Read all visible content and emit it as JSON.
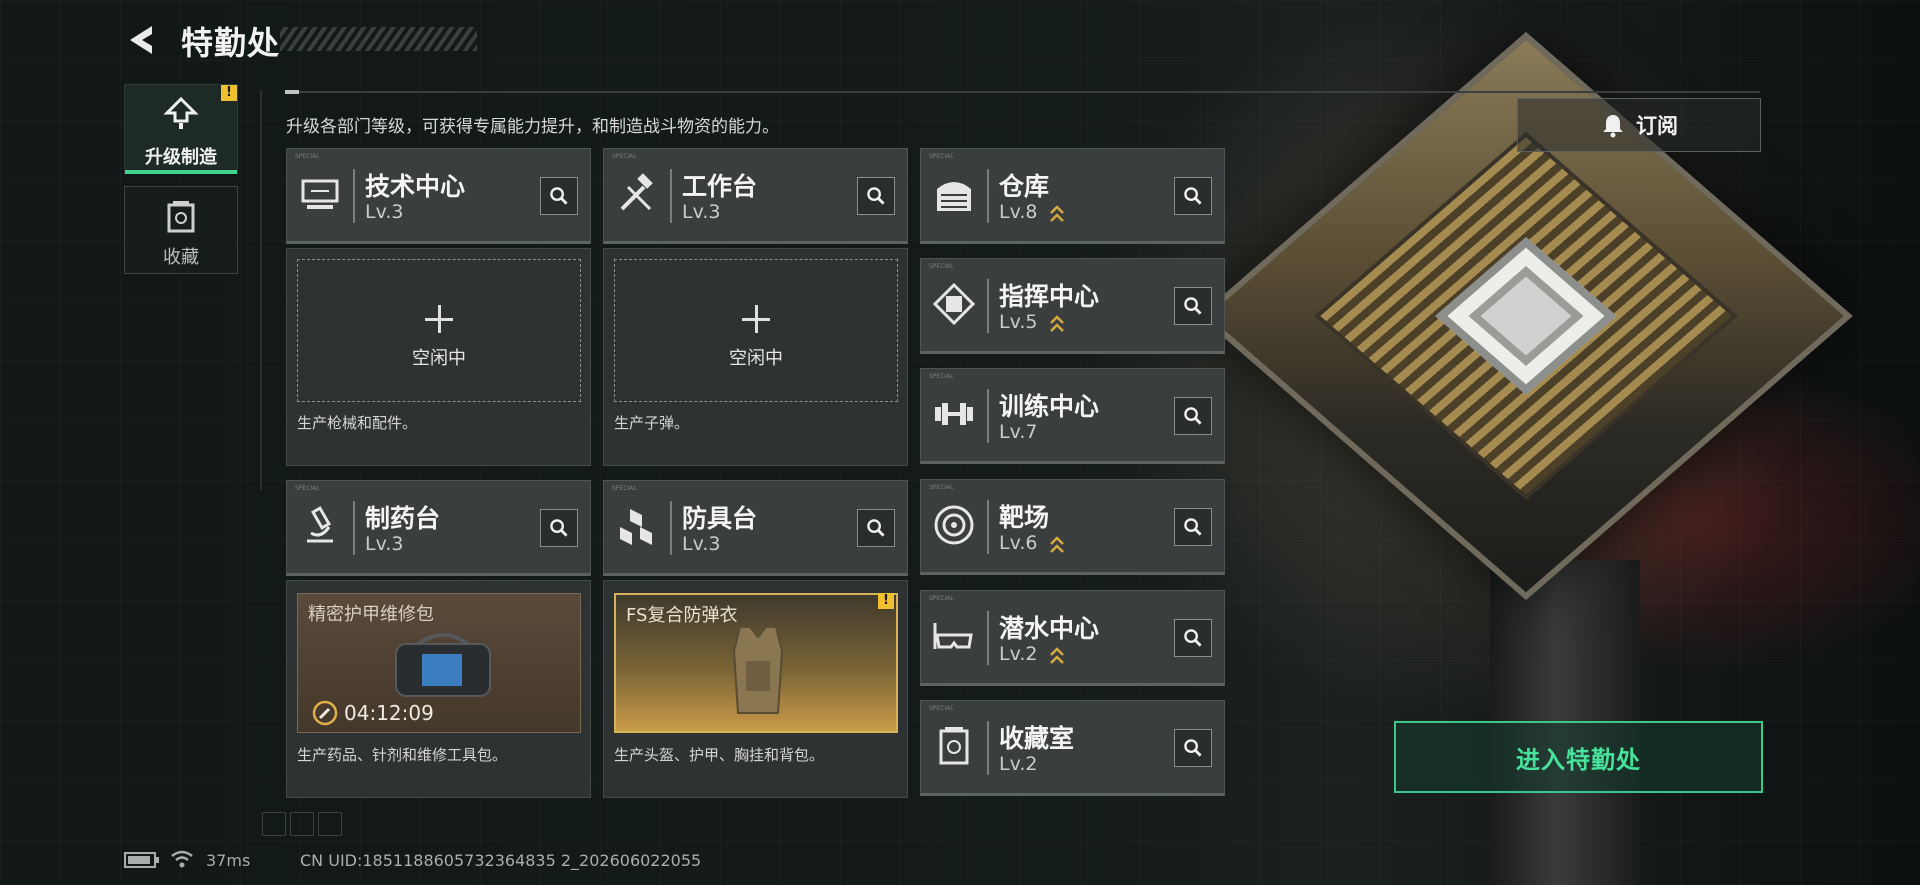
{
  "header": {
    "title": "特勤处"
  },
  "nav": {
    "items": [
      {
        "label": "升级制造",
        "active": true,
        "badge": "!"
      },
      {
        "label": "收藏",
        "active": false
      }
    ]
  },
  "subtitle": "升级各部门等级，可获得专属能力提升，和制造战斗物资的能力。",
  "subscribe_label": "订阅",
  "enter_label": "进入特勤处",
  "departments": {
    "tech_center": {
      "name": "技术中心",
      "level": "Lv.3",
      "slot_text": "空闲中",
      "desc": "生产枪械和配件。"
    },
    "workbench": {
      "name": "工作台",
      "level": "Lv.3",
      "slot_text": "空闲中",
      "desc": "生产子弹。"
    },
    "pharmacy": {
      "name": "制药台",
      "level": "Lv.3",
      "item_name": "精密护甲维修包",
      "timer": "04:12:09",
      "desc": "生产药品、针剂和维修工具包。"
    },
    "armor_bench": {
      "name": "防具台",
      "level": "Lv.3",
      "item_name": "FS复合防弹衣",
      "badge": "!",
      "desc": "生产头盔、护甲、胸挂和背包。"
    },
    "warehouse": {
      "name": "仓库",
      "level": "Lv.8",
      "upgradable": true
    },
    "command_center": {
      "name": "指挥中心",
      "level": "Lv.5",
      "upgradable": true
    },
    "training_center": {
      "name": "训练中心",
      "level": "Lv.7",
      "upgradable": false
    },
    "range": {
      "name": "靶场",
      "level": "Lv.6",
      "upgradable": true
    },
    "diving_center": {
      "name": "潜水中心",
      "level": "Lv.2",
      "upgradable": true
    },
    "collection_room": {
      "name": "收藏室",
      "level": "Lv.2",
      "upgradable": false
    }
  },
  "status_bar": {
    "ping": "37ms",
    "uid": "CN UID:1851188605732364835 2_202606022055"
  },
  "colors": {
    "accent_green": "#3fd38c",
    "warning_yellow": "#f0c030",
    "upgrade_gold": "#d4a93e"
  }
}
